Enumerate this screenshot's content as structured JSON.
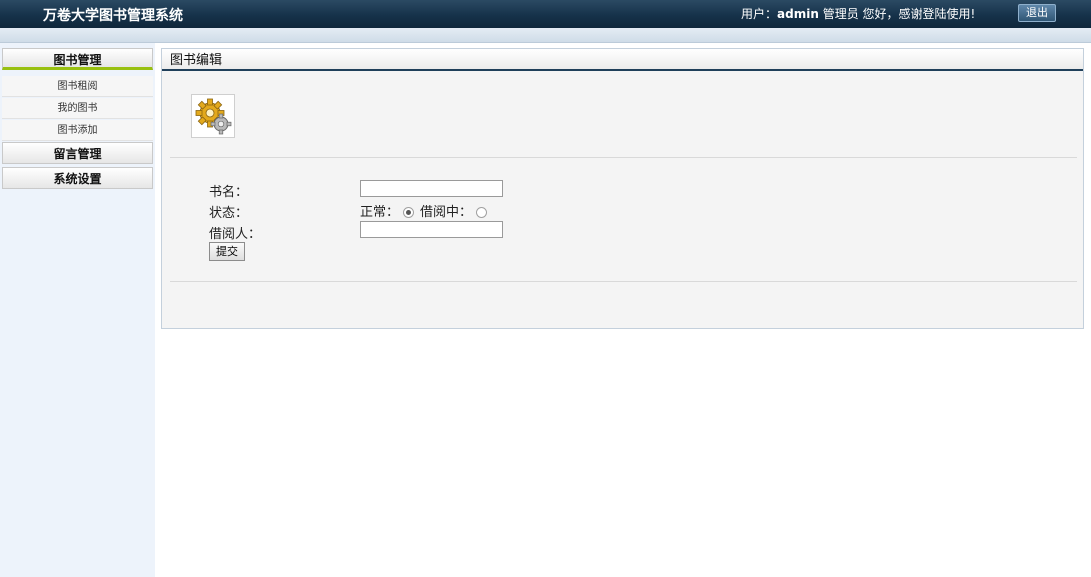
{
  "header": {
    "title": "万卷大学图书管理系统",
    "user_prefix": "用户：",
    "username": "admin",
    "user_suffix": " 管理员 您好，感谢登陆使用!",
    "logout_label": "退出"
  },
  "sidebar": {
    "sections": [
      {
        "label": "图书管理",
        "items": [
          "图书租阅",
          "我的图书",
          "图书添加"
        ]
      },
      {
        "label": "留言管理"
      },
      {
        "label": "系统设置"
      }
    ]
  },
  "panel": {
    "title": "图书编辑",
    "icon": "gear-settings-icon",
    "form": {
      "book_name_label": "书名：",
      "book_name_value": "",
      "status_label": "状态：",
      "status_normal": "正常：",
      "status_borrowed": "借阅中：",
      "status_selected": "正常",
      "borrower_label": "借阅人：",
      "borrower_value": "",
      "submit_label": "提交"
    }
  },
  "colors": {
    "header_bg": "#16324a",
    "accent_green": "#98c010",
    "sidebar_bg": "#edf3fb"
  }
}
